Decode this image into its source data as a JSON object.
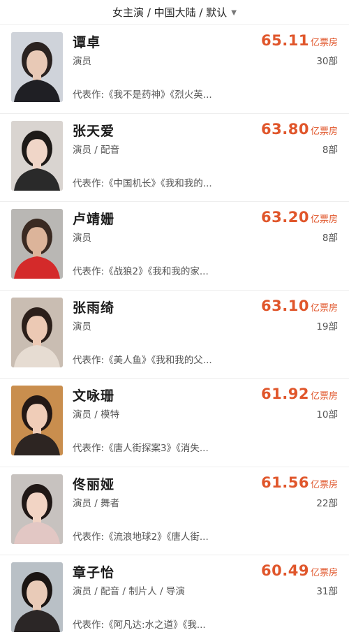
{
  "filter": {
    "label": "女主演 / 中国大陆 / 默认",
    "caret": "▼"
  },
  "box_unit": "亿票房",
  "actors": [
    {
      "name": "谭卓",
      "role": "演员",
      "box": "65.11",
      "count": "30部",
      "works": "代表作:《我不是药神》《烈火英...",
      "palette": {
        "bg": "#cfd3da",
        "hair": "#2a2220",
        "skin": "#e8c9b6",
        "cloth": "#1f1f24"
      }
    },
    {
      "name": "张天爱",
      "role": "演员 / 配音",
      "box": "63.80",
      "count": "8部",
      "works": "代表作:《中国机长》《我和我的...",
      "palette": {
        "bg": "#d9d4d0",
        "hair": "#1e1a18",
        "skin": "#f0d6c8",
        "cloth": "#2a2a2a"
      }
    },
    {
      "name": "卢靖姗",
      "role": "演员",
      "box": "63.20",
      "count": "8部",
      "works": "代表作:《战狼2》《我和我的家...",
      "palette": {
        "bg": "#b9b7b4",
        "hair": "#3a2a22",
        "skin": "#dcb49a",
        "cloth": "#d42a2a"
      }
    },
    {
      "name": "张雨绮",
      "role": "演员",
      "box": "63.10",
      "count": "19部",
      "works": "代表作:《美人鱼》《我和我的父...",
      "palette": {
        "bg": "#c9bdb2",
        "hair": "#2b1f1a",
        "skin": "#ecc9b4",
        "cloth": "#e6dcd2"
      }
    },
    {
      "name": "文咏珊",
      "role": "演员 / 模特",
      "box": "61.92",
      "count": "10部",
      "works": "代表作:《唐人街探案3》《消失...",
      "palette": {
        "bg": "#c98e4e",
        "hair": "#231815",
        "skin": "#f0cdb8",
        "cloth": "#2d2522"
      }
    },
    {
      "name": "佟丽娅",
      "role": "演员 / 舞者",
      "box": "61.56",
      "count": "22部",
      "works": "代表作:《流浪地球2》《唐人街...",
      "palette": {
        "bg": "#c7c2bf",
        "hair": "#201816",
        "skin": "#f2d4c4",
        "cloth": "#e2c7c4"
      }
    },
    {
      "name": "章子怡",
      "role": "演员 / 配音 / 制片人 / 导演",
      "box": "60.49",
      "count": "31部",
      "works": "代表作:《阿凡达:水之道》《我...",
      "palette": {
        "bg": "#b9c0c6",
        "hair": "#1b1513",
        "skin": "#e9cbb8",
        "cloth": "#2b2626"
      }
    }
  ]
}
